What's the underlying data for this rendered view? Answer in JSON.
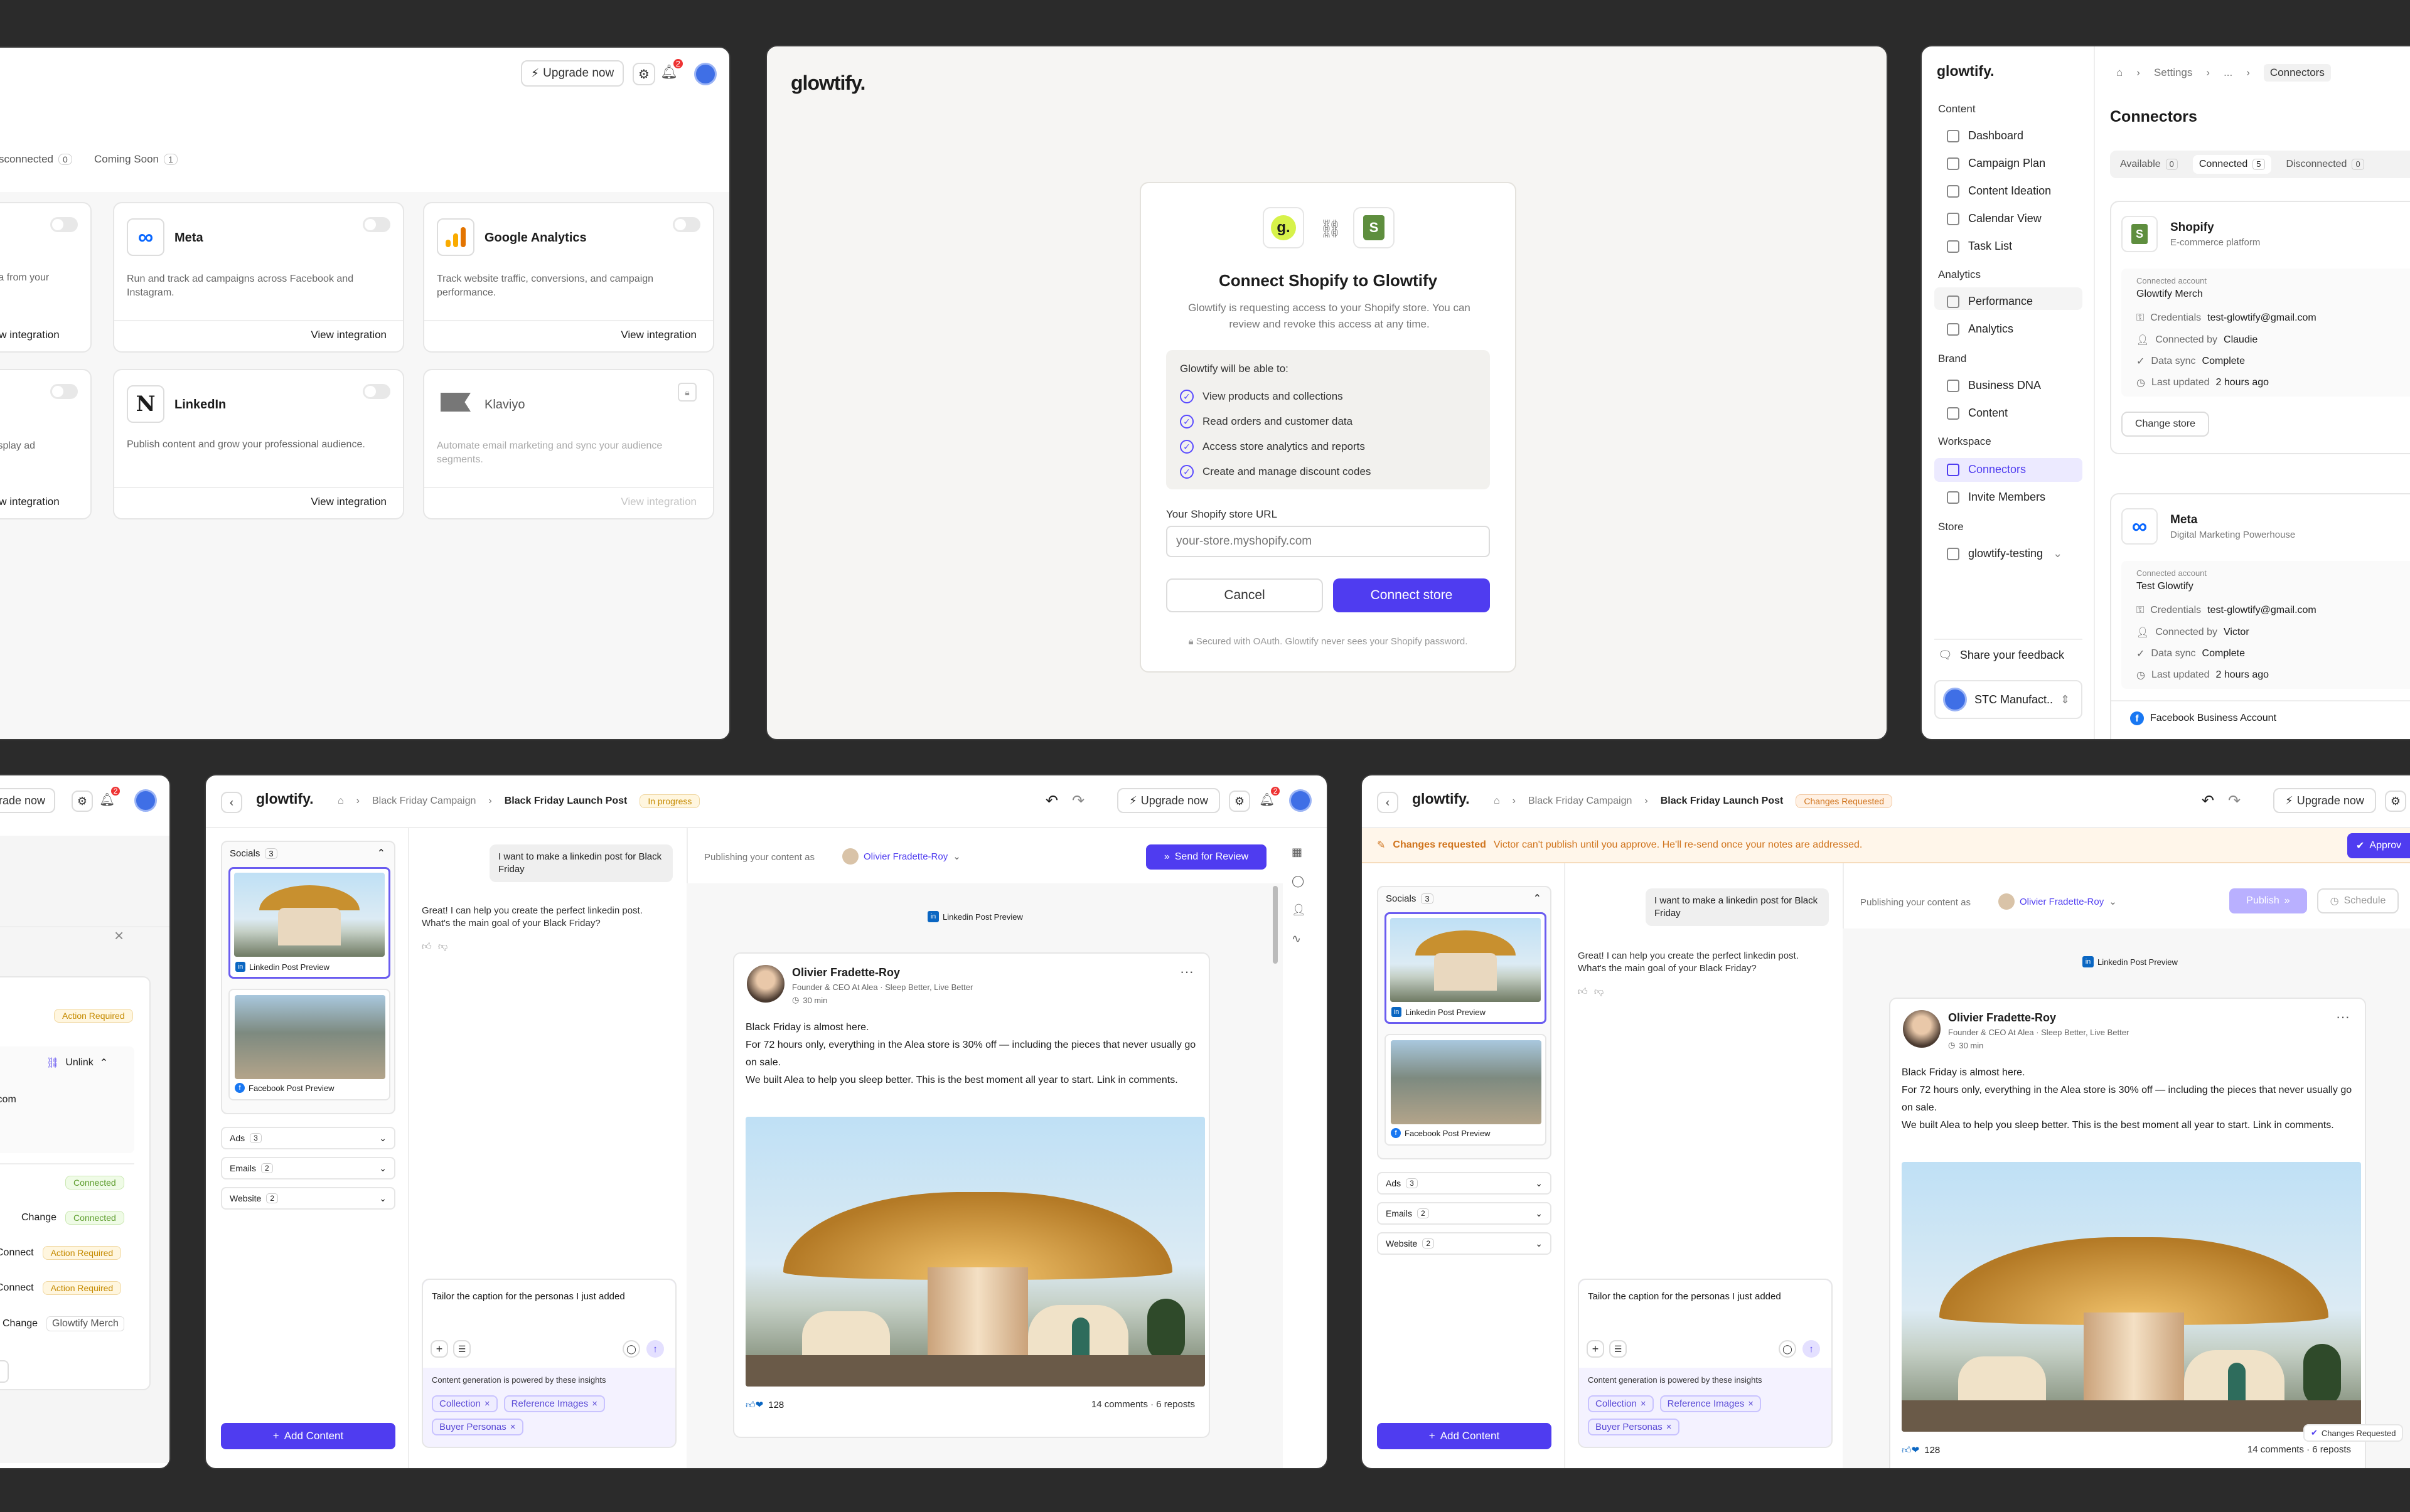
{
  "p1": {
    "upgrade": "Upgrade now",
    "bell_count": "2",
    "tabs": [
      {
        "label": "Disconnected",
        "count": "0"
      },
      {
        "label": "Coming Soon",
        "count": "1"
      }
    ],
    "cards": [
      {
        "name": "",
        "desc": "ata from your",
        "link": "View integration"
      },
      {
        "name": "Meta",
        "desc": "Run and track ad campaigns across Facebook and Instagram.",
        "link": "View integration"
      },
      {
        "name": "Google Analytics",
        "desc": "Track website traffic, conversions, and campaign performance.",
        "link": "View integration"
      },
      {
        "name": "",
        "desc": "display ad",
        "link": "View integration"
      },
      {
        "name": "LinkedIn",
        "desc": "Publish content and grow your professional audience.",
        "link": "View integration"
      },
      {
        "name": "Klaviyo",
        "desc": "Automate email marketing and sync your audience segments.",
        "link": "View integration"
      }
    ]
  },
  "p2": {
    "logo": "glowtify.",
    "title": "Connect Shopify to Glowtify",
    "desc": "Glowtify is requesting access to your Shopify store. You can review and revoke this access at any time.",
    "perm_title": "Glowtify will be able to:",
    "perms": [
      "View products and collections",
      "Read orders and customer data",
      "Access store analytics and reports",
      "Create and manage discount codes"
    ],
    "url_label": "Your Shopify store URL",
    "url_placeholder": "your-store.myshopify.com",
    "cancel": "Cancel",
    "connect": "Connect store",
    "secure": "Secured with OAuth. Glowtify never sees your Shopify password."
  },
  "p3": {
    "logo": "glowtify.",
    "crumbs": [
      "Settings",
      "...",
      "Connectors"
    ],
    "heading": "Connectors",
    "sections": [
      {
        "label": "Content",
        "items": [
          "Dashboard",
          "Campaign Plan",
          "Content Ideation",
          "Calendar View",
          "Task List"
        ]
      },
      {
        "label": "Analytics",
        "items": [
          "Performance",
          "Analytics"
        ]
      },
      {
        "label": "Brand",
        "items": [
          "Business DNA",
          "Content"
        ]
      },
      {
        "label": "Workspace",
        "items": [
          "Connectors",
          "Invite Members"
        ]
      },
      {
        "label": "Store",
        "items": [
          "glowtify-testing"
        ]
      }
    ],
    "feedback": "Share your feedback",
    "org": "STC Manufact..",
    "tabs": [
      {
        "label": "Available",
        "count": "0"
      },
      {
        "label": "Connected",
        "count": "5"
      },
      {
        "label": "Disconnected",
        "count": "0"
      }
    ],
    "conn": [
      {
        "name": "Shopify",
        "sub": "E-commerce platform",
        "acct_label": "Connected account",
        "acct": "Glowtify Merch",
        "cred_k": "Credentials",
        "cred_v": "test-glowtify@gmail.com",
        "by_k": "Connected by",
        "by_v": "Claudie",
        "sync_k": "Data sync",
        "sync_v": "Complete",
        "upd_k": "Last updated",
        "upd_v": "2 hours ago",
        "btn": "Change store"
      },
      {
        "name": "Meta",
        "sub": "Digital Marketing Powerhouse",
        "acct_label": "Connected account",
        "acct": "Test Glowtify",
        "cred_k": "Credentials",
        "cred_v": "test-glowtify@gmail.com",
        "by_k": "Connected by",
        "by_v": "Victor",
        "sync_k": "Data sync",
        "sync_v": "Complete",
        "upd_k": "Last updated",
        "upd_v": "2 hours ago",
        "fb": "Facebook Business Account"
      }
    ]
  },
  "p4": {
    "upgrade": "grade now",
    "bell": "2",
    "action_required": "Action Required",
    "unlink": "Unlink",
    "email_frag": "il.com",
    "rows": [
      {
        "k": "",
        "v": "Connected"
      },
      {
        "k": "Change",
        "v": "Connected"
      },
      {
        "k": "Connect",
        "v": "Action Required"
      },
      {
        "k": "Connect",
        "v": "Action Required"
      },
      {
        "k": "Change",
        "v": "Glowtify Merch"
      }
    ]
  },
  "p5": {
    "logo": "glowtify.",
    "crumbs": [
      "Black Friday Campaign",
      "Black Friday Launch Post"
    ],
    "status": "In progress",
    "upgrade": "Upgrade now",
    "bell": "2",
    "cats": [
      {
        "label": "Socials",
        "count": "3"
      },
      {
        "label": "Ads",
        "count": "3"
      },
      {
        "label": "Emails",
        "count": "2"
      },
      {
        "label": "Website",
        "count": "2"
      }
    ],
    "thumb1": "Linkedin Post Preview",
    "thumb2": "Facebook Post Preview",
    "add": "Add Content",
    "user_msg": "I want to make a linkedin post for Black Friday",
    "ai_msg": "Great! I can help you create the perfect linkedin post. What's the main goal of your Black Friday?",
    "prompt": "Tailor the caption for the personas I just added",
    "insights": "Content generation is powered by these insights",
    "tags": [
      "Collection",
      "Reference Images",
      "Buyer Personas"
    ],
    "pub_as": "Publishing your content as",
    "author": "Olivier Fradette-Roy",
    "send": "Send for Review",
    "preview": "Linkedin Post Preview",
    "post_name": "Olivier Fradette-Roy",
    "post_role": "Founder & CEO At Alea · Sleep Better, Live Better",
    "post_time": "30 min",
    "post_lines": [
      "Black Friday is almost here.",
      "For 72 hours only, everything in the Alea store is 30% off — including the pieces that never usually go on sale.",
      "We built Alea to help you sleep better. This is the best moment all year to start. Link in comments."
    ],
    "reactions": "128",
    "stats": "14 comments · 6 reposts"
  },
  "p6": {
    "logo": "glowtify.",
    "crumbs": [
      "Black Friday Campaign",
      "Black Friday Launch Post"
    ],
    "status": "Changes Requested",
    "upgrade": "Upgrade now",
    "banner_b": "Changes requested",
    "banner": "Victor can't publish until you approve. He'll re-send once your notes are addressed.",
    "approve": "Approv",
    "publish": "Publish",
    "schedule": "Schedule",
    "cr_badge": "Changes Requested"
  },
  "colors": {
    "accent": "#4f3cf0",
    "bg": "#2b2b2b"
  }
}
